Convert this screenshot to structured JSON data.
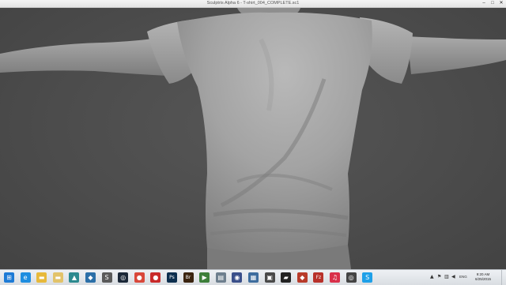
{
  "window": {
    "title": "Sculptris Alpha 6 - T-shirt_004_COMPLETE.sc1",
    "minimize_glyph": "–",
    "maximize_glyph": "□",
    "close_glyph": "✕"
  },
  "taskbar": {
    "apps": [
      {
        "name": "start-icon",
        "glyph": "⊞",
        "color": "#1e7bd6"
      },
      {
        "name": "internet-explorer-icon",
        "glyph": "e",
        "color": "#1f8ee0"
      },
      {
        "name": "file-explorer-icon",
        "glyph": "▬",
        "color": "#e7b93b"
      },
      {
        "name": "folder-icon",
        "glyph": "▬",
        "color": "#e2c36a"
      },
      {
        "name": "photos-icon",
        "glyph": "▲",
        "color": "#2c8a8f"
      },
      {
        "name": "maps-icon",
        "glyph": "◆",
        "color": "#2b6fa8"
      },
      {
        "name": "sculptris-icon",
        "glyph": "S",
        "color": "#5a5a5a"
      },
      {
        "name": "steam-icon",
        "glyph": "◎",
        "color": "#1b2838"
      },
      {
        "name": "chrome-icon",
        "glyph": "●",
        "color": "#d9483b"
      },
      {
        "name": "record-icon",
        "glyph": "●",
        "color": "#c92a2a"
      },
      {
        "name": "photoshop-icon",
        "glyph": "Ps",
        "color": "#0d2f4f"
      },
      {
        "name": "bridge-icon",
        "glyph": "Br",
        "color": "#3b2410"
      },
      {
        "name": "media-player-icon",
        "glyph": "▶",
        "color": "#3d7f3a"
      },
      {
        "name": "devices-icon",
        "glyph": "▤",
        "color": "#6e7f8e"
      },
      {
        "name": "media-icon",
        "glyph": "◉",
        "color": "#3a4f8a"
      },
      {
        "name": "network-icon",
        "glyph": "▦",
        "color": "#3e6d9e"
      },
      {
        "name": "calculator-icon",
        "glyph": "▣",
        "color": "#4a4a4a"
      },
      {
        "name": "nvidia-icon",
        "glyph": "▰",
        "color": "#222"
      },
      {
        "name": "fire-icon",
        "glyph": "◆",
        "color": "#b83b2a"
      },
      {
        "name": "filezilla-icon",
        "glyph": "Fz",
        "color": "#b8312a"
      },
      {
        "name": "itunes-icon",
        "glyph": "♫",
        "color": "#d9304a"
      },
      {
        "name": "cd-icon",
        "glyph": "◎",
        "color": "#444"
      },
      {
        "name": "skype-icon",
        "glyph": "S",
        "color": "#1ea0e8"
      }
    ],
    "tray_icons": [
      {
        "name": "tray-expand-icon",
        "glyph": "▲"
      },
      {
        "name": "tray-flag-icon",
        "glyph": "⚑"
      },
      {
        "name": "tray-network-icon",
        "glyph": "▥"
      },
      {
        "name": "tray-volume-icon",
        "glyph": "◀"
      }
    ],
    "language": "ENG",
    "clock_time": "9:20 AM",
    "clock_date": "6/25/2015"
  }
}
